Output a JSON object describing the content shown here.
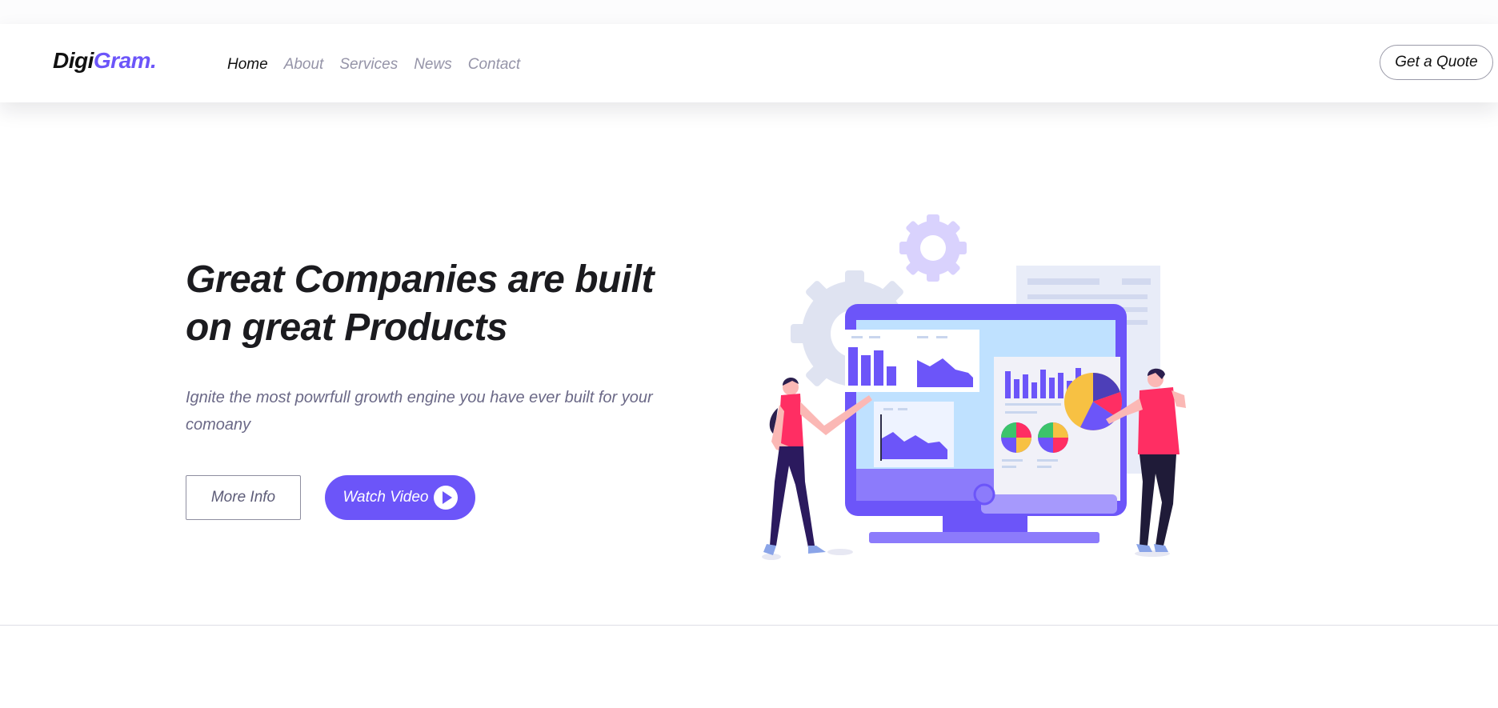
{
  "brand": {
    "part1": "Digi",
    "part2": "Gram."
  },
  "nav": {
    "items": [
      {
        "label": "Home",
        "active": true
      },
      {
        "label": "About",
        "active": false
      },
      {
        "label": "Services",
        "active": false
      },
      {
        "label": "News",
        "active": false
      },
      {
        "label": "Contact",
        "active": false
      }
    ],
    "cta": "Get a Quote"
  },
  "hero": {
    "title": "Great Companies are built on great Products",
    "subtitle": "Ignite the most powrfull growth engine you have ever built for your comoany",
    "primary_button": "More Info",
    "secondary_button": "Watch Video"
  },
  "colors": {
    "accent": "#6c55f9",
    "heading": "#1b1b1f",
    "muted": "#9594a8",
    "subtitle": "#6b6987",
    "pink": "#ff2e63",
    "yellow": "#f7c143"
  },
  "icons": {
    "play": "play-icon",
    "illustration": "analytics-dashboard-illustration"
  }
}
